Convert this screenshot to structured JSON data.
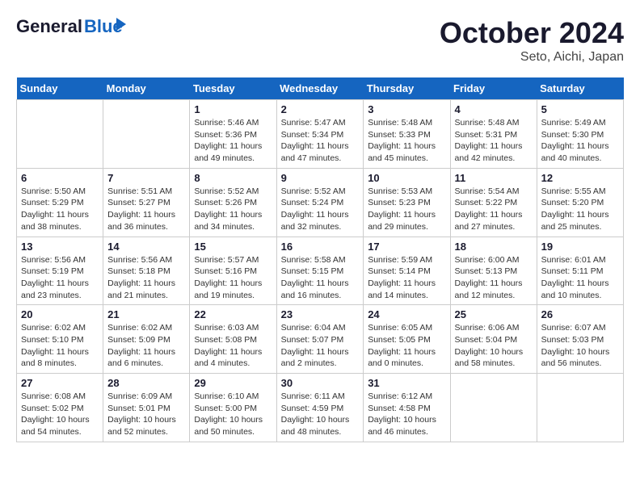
{
  "header": {
    "logo_general": "General",
    "logo_blue": "Blue",
    "month_title": "October 2024",
    "location": "Seto, Aichi, Japan"
  },
  "days_of_week": [
    "Sunday",
    "Monday",
    "Tuesday",
    "Wednesday",
    "Thursday",
    "Friday",
    "Saturday"
  ],
  "weeks": [
    [
      {
        "day": "",
        "info": ""
      },
      {
        "day": "",
        "info": ""
      },
      {
        "day": "1",
        "sunrise": "Sunrise: 5:46 AM",
        "sunset": "Sunset: 5:36 PM",
        "daylight": "Daylight: 11 hours and 49 minutes."
      },
      {
        "day": "2",
        "sunrise": "Sunrise: 5:47 AM",
        "sunset": "Sunset: 5:34 PM",
        "daylight": "Daylight: 11 hours and 47 minutes."
      },
      {
        "day": "3",
        "sunrise": "Sunrise: 5:48 AM",
        "sunset": "Sunset: 5:33 PM",
        "daylight": "Daylight: 11 hours and 45 minutes."
      },
      {
        "day": "4",
        "sunrise": "Sunrise: 5:48 AM",
        "sunset": "Sunset: 5:31 PM",
        "daylight": "Daylight: 11 hours and 42 minutes."
      },
      {
        "day": "5",
        "sunrise": "Sunrise: 5:49 AM",
        "sunset": "Sunset: 5:30 PM",
        "daylight": "Daylight: 11 hours and 40 minutes."
      }
    ],
    [
      {
        "day": "6",
        "sunrise": "Sunrise: 5:50 AM",
        "sunset": "Sunset: 5:29 PM",
        "daylight": "Daylight: 11 hours and 38 minutes."
      },
      {
        "day": "7",
        "sunrise": "Sunrise: 5:51 AM",
        "sunset": "Sunset: 5:27 PM",
        "daylight": "Daylight: 11 hours and 36 minutes."
      },
      {
        "day": "8",
        "sunrise": "Sunrise: 5:52 AM",
        "sunset": "Sunset: 5:26 PM",
        "daylight": "Daylight: 11 hours and 34 minutes."
      },
      {
        "day": "9",
        "sunrise": "Sunrise: 5:52 AM",
        "sunset": "Sunset: 5:24 PM",
        "daylight": "Daylight: 11 hours and 32 minutes."
      },
      {
        "day": "10",
        "sunrise": "Sunrise: 5:53 AM",
        "sunset": "Sunset: 5:23 PM",
        "daylight": "Daylight: 11 hours and 29 minutes."
      },
      {
        "day": "11",
        "sunrise": "Sunrise: 5:54 AM",
        "sunset": "Sunset: 5:22 PM",
        "daylight": "Daylight: 11 hours and 27 minutes."
      },
      {
        "day": "12",
        "sunrise": "Sunrise: 5:55 AM",
        "sunset": "Sunset: 5:20 PM",
        "daylight": "Daylight: 11 hours and 25 minutes."
      }
    ],
    [
      {
        "day": "13",
        "sunrise": "Sunrise: 5:56 AM",
        "sunset": "Sunset: 5:19 PM",
        "daylight": "Daylight: 11 hours and 23 minutes."
      },
      {
        "day": "14",
        "sunrise": "Sunrise: 5:56 AM",
        "sunset": "Sunset: 5:18 PM",
        "daylight": "Daylight: 11 hours and 21 minutes."
      },
      {
        "day": "15",
        "sunrise": "Sunrise: 5:57 AM",
        "sunset": "Sunset: 5:16 PM",
        "daylight": "Daylight: 11 hours and 19 minutes."
      },
      {
        "day": "16",
        "sunrise": "Sunrise: 5:58 AM",
        "sunset": "Sunset: 5:15 PM",
        "daylight": "Daylight: 11 hours and 16 minutes."
      },
      {
        "day": "17",
        "sunrise": "Sunrise: 5:59 AM",
        "sunset": "Sunset: 5:14 PM",
        "daylight": "Daylight: 11 hours and 14 minutes."
      },
      {
        "day": "18",
        "sunrise": "Sunrise: 6:00 AM",
        "sunset": "Sunset: 5:13 PM",
        "daylight": "Daylight: 11 hours and 12 minutes."
      },
      {
        "day": "19",
        "sunrise": "Sunrise: 6:01 AM",
        "sunset": "Sunset: 5:11 PM",
        "daylight": "Daylight: 11 hours and 10 minutes."
      }
    ],
    [
      {
        "day": "20",
        "sunrise": "Sunrise: 6:02 AM",
        "sunset": "Sunset: 5:10 PM",
        "daylight": "Daylight: 11 hours and 8 minutes."
      },
      {
        "day": "21",
        "sunrise": "Sunrise: 6:02 AM",
        "sunset": "Sunset: 5:09 PM",
        "daylight": "Daylight: 11 hours and 6 minutes."
      },
      {
        "day": "22",
        "sunrise": "Sunrise: 6:03 AM",
        "sunset": "Sunset: 5:08 PM",
        "daylight": "Daylight: 11 hours and 4 minutes."
      },
      {
        "day": "23",
        "sunrise": "Sunrise: 6:04 AM",
        "sunset": "Sunset: 5:07 PM",
        "daylight": "Daylight: 11 hours and 2 minutes."
      },
      {
        "day": "24",
        "sunrise": "Sunrise: 6:05 AM",
        "sunset": "Sunset: 5:05 PM",
        "daylight": "Daylight: 11 hours and 0 minutes."
      },
      {
        "day": "25",
        "sunrise": "Sunrise: 6:06 AM",
        "sunset": "Sunset: 5:04 PM",
        "daylight": "Daylight: 10 hours and 58 minutes."
      },
      {
        "day": "26",
        "sunrise": "Sunrise: 6:07 AM",
        "sunset": "Sunset: 5:03 PM",
        "daylight": "Daylight: 10 hours and 56 minutes."
      }
    ],
    [
      {
        "day": "27",
        "sunrise": "Sunrise: 6:08 AM",
        "sunset": "Sunset: 5:02 PM",
        "daylight": "Daylight: 10 hours and 54 minutes."
      },
      {
        "day": "28",
        "sunrise": "Sunrise: 6:09 AM",
        "sunset": "Sunset: 5:01 PM",
        "daylight": "Daylight: 10 hours and 52 minutes."
      },
      {
        "day": "29",
        "sunrise": "Sunrise: 6:10 AM",
        "sunset": "Sunset: 5:00 PM",
        "daylight": "Daylight: 10 hours and 50 minutes."
      },
      {
        "day": "30",
        "sunrise": "Sunrise: 6:11 AM",
        "sunset": "Sunset: 4:59 PM",
        "daylight": "Daylight: 10 hours and 48 minutes."
      },
      {
        "day": "31",
        "sunrise": "Sunrise: 6:12 AM",
        "sunset": "Sunset: 4:58 PM",
        "daylight": "Daylight: 10 hours and 46 minutes."
      },
      {
        "day": "",
        "info": ""
      },
      {
        "day": "",
        "info": ""
      }
    ]
  ]
}
